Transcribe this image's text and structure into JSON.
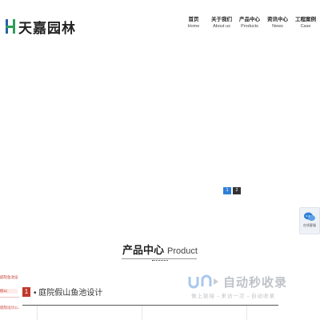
{
  "header": {
    "logo_text": "天嘉园林",
    "nav": [
      {
        "cn": "首页",
        "en": "Home"
      },
      {
        "cn": "关于我们",
        "en": "About us"
      },
      {
        "cn": "产品中心",
        "en": "Products"
      },
      {
        "cn": "资讯中心",
        "en": "News"
      },
      {
        "cn": "工程案例",
        "en": "Case"
      }
    ]
  },
  "banner": {
    "pager": [
      "1",
      "2"
    ],
    "active_page": 1
  },
  "float_service": {
    "label": "在线客服"
  },
  "products_section": {
    "title_cn": "产品中心",
    "title_en": "Product",
    "side_categories": [
      "庭院鱼池设计",
      "假山",
      "庭院设计公司"
    ],
    "item_number": "1",
    "item_title": "• 庭院假山鱼池设计"
  },
  "watermark": {
    "main": "自动秒收录",
    "sub": "做上链接→来访一次→自动收录"
  },
  "colors": {
    "accent_blue": "#2f7fd8",
    "accent_red": "#c0392b",
    "logo_green": "#2e9e5b"
  }
}
